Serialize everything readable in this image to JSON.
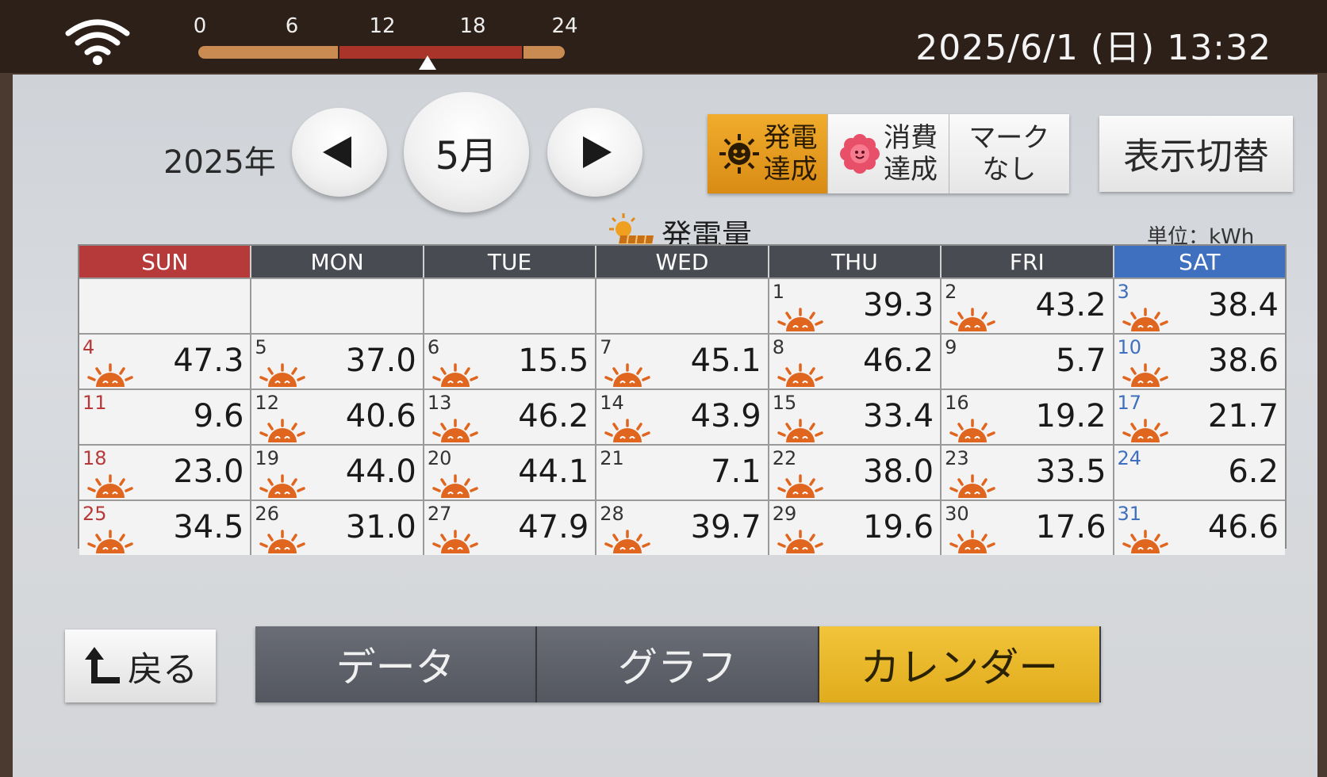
{
  "status_bar": {
    "wifi_icon": "wifi-icon",
    "timeline_ticks": [
      "0",
      "6",
      "12",
      "18",
      "24"
    ],
    "datetime": "2025/6/1 (日) 13:32"
  },
  "header": {
    "year": "2025年",
    "month": "5月",
    "prev_icon": "triangle-left-icon",
    "next_icon": "triangle-right-icon"
  },
  "mark_options": [
    {
      "label": "発電\n達成",
      "icon": "sun-face-icon",
      "active": true
    },
    {
      "label": "消費\n達成",
      "icon": "flower-icon",
      "active": false
    },
    {
      "label": "マーク\nなし",
      "icon": "",
      "active": false
    }
  ],
  "switch_button": "表示切替",
  "calendar": {
    "title": "発電量",
    "unit": "単位：kWh",
    "weekdays": [
      "SUN",
      "MON",
      "TUE",
      "WED",
      "THU",
      "FRI",
      "SAT"
    ],
    "weeks": [
      [
        null,
        null,
        null,
        null,
        {
          "day": "1",
          "value": "39.3",
          "sun": true
        },
        {
          "day": "2",
          "value": "43.2",
          "sun": true
        },
        {
          "day": "3",
          "value": "38.4",
          "sun": true
        }
      ],
      [
        {
          "day": "4",
          "value": "47.3",
          "sun": true
        },
        {
          "day": "5",
          "value": "37.0",
          "sun": true
        },
        {
          "day": "6",
          "value": "15.5",
          "sun": true
        },
        {
          "day": "7",
          "value": "45.1",
          "sun": true
        },
        {
          "day": "8",
          "value": "46.2",
          "sun": true
        },
        {
          "day": "9",
          "value": "5.7",
          "sun": false
        },
        {
          "day": "10",
          "value": "38.6",
          "sun": true
        }
      ],
      [
        {
          "day": "11",
          "value": "9.6",
          "sun": false
        },
        {
          "day": "12",
          "value": "40.6",
          "sun": true
        },
        {
          "day": "13",
          "value": "46.2",
          "sun": true
        },
        {
          "day": "14",
          "value": "43.9",
          "sun": true
        },
        {
          "day": "15",
          "value": "33.4",
          "sun": true
        },
        {
          "day": "16",
          "value": "19.2",
          "sun": true
        },
        {
          "day": "17",
          "value": "21.7",
          "sun": true
        }
      ],
      [
        {
          "day": "18",
          "value": "23.0",
          "sun": true
        },
        {
          "day": "19",
          "value": "44.0",
          "sun": true
        },
        {
          "day": "20",
          "value": "44.1",
          "sun": true
        },
        {
          "day": "21",
          "value": "7.1",
          "sun": false
        },
        {
          "day": "22",
          "value": "38.0",
          "sun": true
        },
        {
          "day": "23",
          "value": "33.5",
          "sun": true
        },
        {
          "day": "24",
          "value": "6.2",
          "sun": false
        }
      ],
      [
        {
          "day": "25",
          "value": "34.5",
          "sun": true
        },
        {
          "day": "26",
          "value": "31.0",
          "sun": true
        },
        {
          "day": "27",
          "value": "47.9",
          "sun": true
        },
        {
          "day": "28",
          "value": "39.7",
          "sun": true
        },
        {
          "day": "29",
          "value": "19.6",
          "sun": true
        },
        {
          "day": "30",
          "value": "17.6",
          "sun": true
        },
        {
          "day": "31",
          "value": "46.6",
          "sun": true
        }
      ]
    ]
  },
  "bottom": {
    "back_label": "戻る",
    "tabs": [
      {
        "label": "データ",
        "active": false
      },
      {
        "label": "グラフ",
        "active": false
      },
      {
        "label": "カレンダー",
        "active": true
      }
    ]
  },
  "colors": {
    "sunday": "#b63a3a",
    "saturday": "#3f6fbf",
    "weekday_header": "#494b53",
    "active_mark": "#e09a20",
    "active_tab": "#e8b82a",
    "sun_icon": "#e0651e"
  }
}
